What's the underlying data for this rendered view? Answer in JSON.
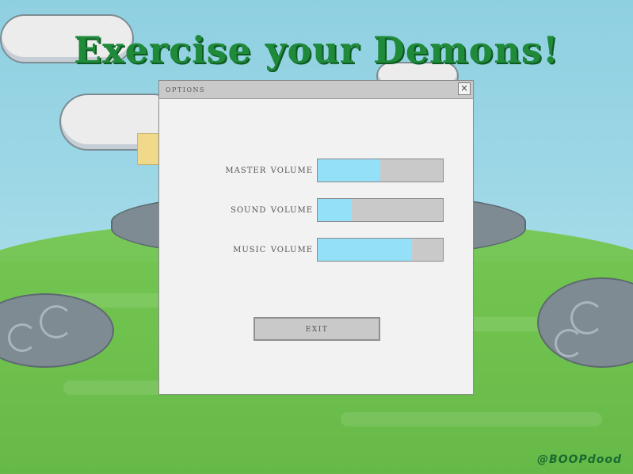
{
  "game": {
    "title": "Exercise your Demons!",
    "credit": "@BOOPdood"
  },
  "options_dialog": {
    "title": "options",
    "close_glyph": "×",
    "sliders": [
      {
        "label": "master volume",
        "value": 0.5
      },
      {
        "label": "sound volume",
        "value": 0.27
      },
      {
        "label": "music volume",
        "value": 0.75
      }
    ],
    "exit_label": "exit"
  },
  "colors": {
    "slider_fill": "#93e0f8",
    "slider_track": "#c9c9c9",
    "title_green": "#1f8a3a"
  }
}
